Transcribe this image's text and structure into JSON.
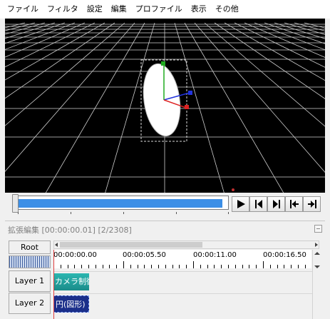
{
  "menu": [
    "ファイル",
    "フィルタ",
    "設定",
    "編集",
    "プロファイル",
    "表示",
    "その他"
  ],
  "timeline": {
    "title": "拡張編集 [00:00:00.01] [2/2308]",
    "root_label": "Root",
    "ruler_labels": [
      "00:00:00.00",
      "00:00:05.50",
      "00:00:11.00",
      "00:00:16.50"
    ],
    "layers": [
      {
        "label": "Layer 1",
        "clip": "カメラ制御"
      },
      {
        "label": "Layer 2",
        "clip": "円(図形)"
      }
    ]
  },
  "seek": {
    "progress": 0.98
  },
  "colors": {
    "seek_fill": "#3c8fe6",
    "camera_clip": "#1f9f9c",
    "shape_clip": "#1b2f8a"
  },
  "icons": [
    "play-icon",
    "prev-frame-icon",
    "next-frame-icon",
    "go-start-icon",
    "go-end-icon"
  ]
}
